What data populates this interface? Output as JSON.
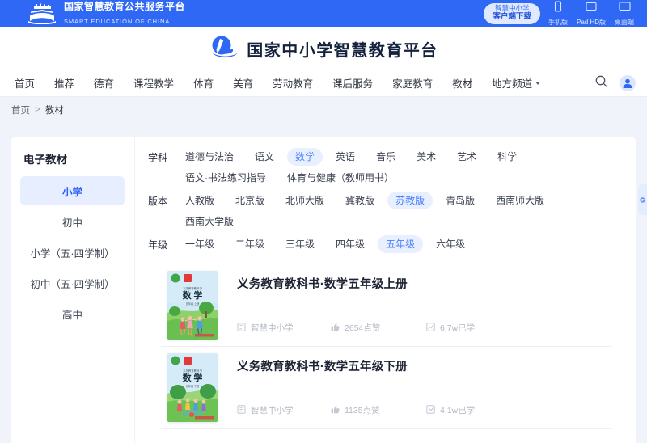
{
  "topbar": {
    "gov_cn": "国家智慧教育公共服务平台",
    "gov_en": "SMART EDUCATION OF CHINA",
    "download": {
      "line1": "智慧中小学",
      "line2": "客户端下载"
    },
    "devices": [
      {
        "label": "手机版",
        "icon": "phone-icon"
      },
      {
        "label": "Pad HD版",
        "icon": "tablet-icon"
      },
      {
        "label": "桌面端",
        "icon": "desktop-icon"
      }
    ]
  },
  "brand": {
    "title": "国家中小学智慧教育平台",
    "logo_icon": "book-wave-logo-icon"
  },
  "nav": {
    "items": [
      {
        "label": "首页"
      },
      {
        "label": "推荐"
      },
      {
        "label": "德育"
      },
      {
        "label": "课程教学"
      },
      {
        "label": "体育"
      },
      {
        "label": "美育"
      },
      {
        "label": "劳动教育"
      },
      {
        "label": "课后服务"
      },
      {
        "label": "家庭教育"
      },
      {
        "label": "教材"
      },
      {
        "label": "地方频道",
        "caret": true
      }
    ],
    "search_icon": "search-icon",
    "avatar_icon": "user-avatar-icon"
  },
  "breadcrumb": {
    "home": "首页",
    "separator": ">",
    "current": "教材"
  },
  "sidebar": {
    "title": "电子教材",
    "items": [
      {
        "label": "小学",
        "active": true
      },
      {
        "label": "初中",
        "active": false
      },
      {
        "label": "小学（五·四学制）",
        "active": false
      },
      {
        "label": "初中（五·四学制）",
        "active": false
      },
      {
        "label": "高中",
        "active": false
      }
    ]
  },
  "filters": [
    {
      "key": "学科",
      "options": [
        {
          "label": "道德与法治",
          "active": false
        },
        {
          "label": "语文",
          "active": false
        },
        {
          "label": "数学",
          "active": true
        },
        {
          "label": "英语",
          "active": false
        },
        {
          "label": "音乐",
          "active": false
        },
        {
          "label": "美术",
          "active": false
        },
        {
          "label": "艺术",
          "active": false
        },
        {
          "label": "科学",
          "active": false
        },
        {
          "label": "语文·书法练习指导",
          "active": false
        },
        {
          "label": "体育与健康（教师用书）",
          "active": false
        }
      ]
    },
    {
      "key": "版本",
      "options": [
        {
          "label": "人教版",
          "active": false
        },
        {
          "label": "北京版",
          "active": false
        },
        {
          "label": "北师大版",
          "active": false
        },
        {
          "label": "冀教版",
          "active": false
        },
        {
          "label": "苏教版",
          "active": true
        },
        {
          "label": "青岛版",
          "active": false
        },
        {
          "label": "西南师大版",
          "active": false
        },
        {
          "label": "西南大学版",
          "active": false
        }
      ]
    },
    {
      "key": "年级",
      "options": [
        {
          "label": "一年级",
          "active": false
        },
        {
          "label": "二年级",
          "active": false
        },
        {
          "label": "三年级",
          "active": false
        },
        {
          "label": "四年级",
          "active": false
        },
        {
          "label": "五年级",
          "active": true
        },
        {
          "label": "六年级",
          "active": false
        }
      ]
    }
  ],
  "books": [
    {
      "title": "义务教育教科书·数学五年级上册",
      "cover_subject": "数 学",
      "cover_series": "义务教育教科书",
      "cover_grade": "五年级  上册",
      "source": "智慧中小学",
      "likes": "2654点赞",
      "learners": "6.7w已学",
      "source_icon": "book-source-icon",
      "like_icon": "thumbs-up-icon",
      "learn_icon": "study-chart-icon"
    },
    {
      "title": "义务教育教科书·数学五年级下册",
      "cover_subject": "数 学",
      "cover_series": "义务教育教科书",
      "cover_grade": "五年级  下册",
      "source": "智慧中小学",
      "likes": "1135点赞",
      "learners": "4.1w已学",
      "source_icon": "book-source-icon",
      "like_icon": "thumbs-up-icon",
      "learn_icon": "study-chart-icon"
    }
  ],
  "edge_tab": {
    "icon": "feedback-tab-icon"
  },
  "colors": {
    "brand_blue": "#2f68f5",
    "accent_blue": "#4a7eff",
    "active_chip_bg": "#e8f0ff",
    "sidebar_active_bg": "#e6eeff",
    "page_bg": "#f0f3fa"
  }
}
